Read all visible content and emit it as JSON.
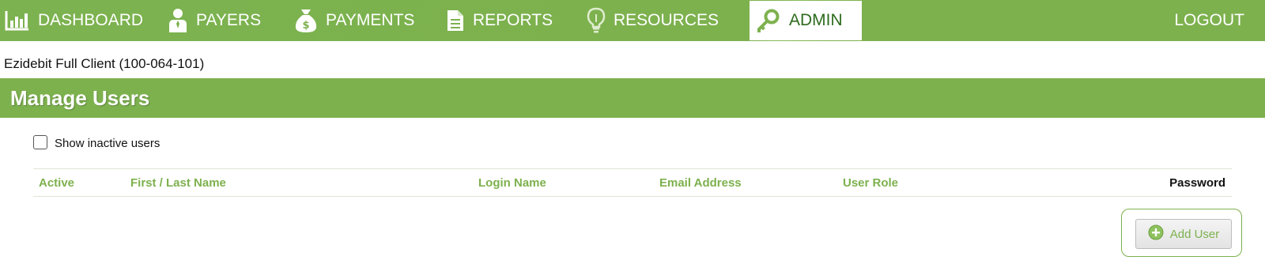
{
  "nav": {
    "dashboard": "DASHBOARD",
    "payers": "PAYERS",
    "payments": "PAYMENTS",
    "reports": "REPORTS",
    "resources": "RESOURCES",
    "admin": "ADMIN",
    "logout": "LOGOUT",
    "active_item": "ADMIN"
  },
  "client": {
    "name": "Ezidebit Full Client (100-064-101)"
  },
  "page": {
    "title": "Manage Users"
  },
  "filters": {
    "show_inactive_label": "Show inactive users",
    "show_inactive_checked": false
  },
  "table": {
    "columns": [
      "Active",
      "First / Last Name",
      "Login Name",
      "Email Address",
      "User Role",
      "Password"
    ],
    "rows": []
  },
  "actions": {
    "add_user_label": "Add User"
  },
  "colors": {
    "brand_green": "#7db14e",
    "active_nav_text": "#2e6b1e",
    "white": "#ffffff"
  },
  "icons": {
    "dashboard": "bar-chart-icon",
    "payers": "person-icon",
    "payments": "money-bag-icon",
    "reports": "document-icon",
    "resources": "lightbulb-icon",
    "admin": "key-icon",
    "add_user": "plus-circle-icon"
  }
}
